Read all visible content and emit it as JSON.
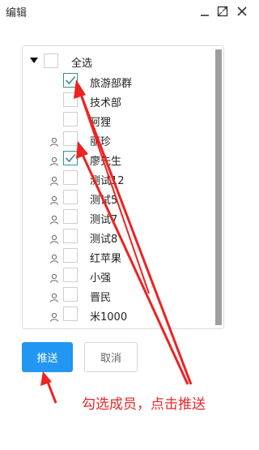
{
  "window": {
    "title": "编辑",
    "icons": [
      "minimize-icon",
      "maximize-icon",
      "close-icon"
    ]
  },
  "tree": {
    "root": {
      "label": "全选",
      "checked": false,
      "expanded": true
    },
    "items": [
      {
        "label": "旅游部群",
        "checked": true,
        "type": "group"
      },
      {
        "label": "技术部",
        "checked": false,
        "type": "group"
      },
      {
        "label": "阿狸",
        "checked": false,
        "type": "group"
      },
      {
        "label": "丽珍",
        "checked": false,
        "type": "user"
      },
      {
        "label": "廖先生",
        "checked": true,
        "type": "user"
      },
      {
        "label": "测试12",
        "checked": false,
        "type": "user"
      },
      {
        "label": "测试5",
        "checked": false,
        "type": "user"
      },
      {
        "label": "测试7",
        "checked": false,
        "type": "user"
      },
      {
        "label": "测试8",
        "checked": false,
        "type": "user"
      },
      {
        "label": "红苹果",
        "checked": false,
        "type": "user"
      },
      {
        "label": "小强",
        "checked": false,
        "type": "user"
      },
      {
        "label": "晋民",
        "checked": false,
        "type": "user"
      },
      {
        "label": "米1000",
        "checked": false,
        "type": "user"
      }
    ]
  },
  "buttons": {
    "push_label": "推送",
    "cancel_label": "取消"
  },
  "annotation": {
    "text": "勾选成员，点击推送",
    "color": "#e8282a"
  },
  "colors": {
    "primary": "#2196f3",
    "check": "#3a8f8a",
    "arrow": "#ee2222"
  }
}
